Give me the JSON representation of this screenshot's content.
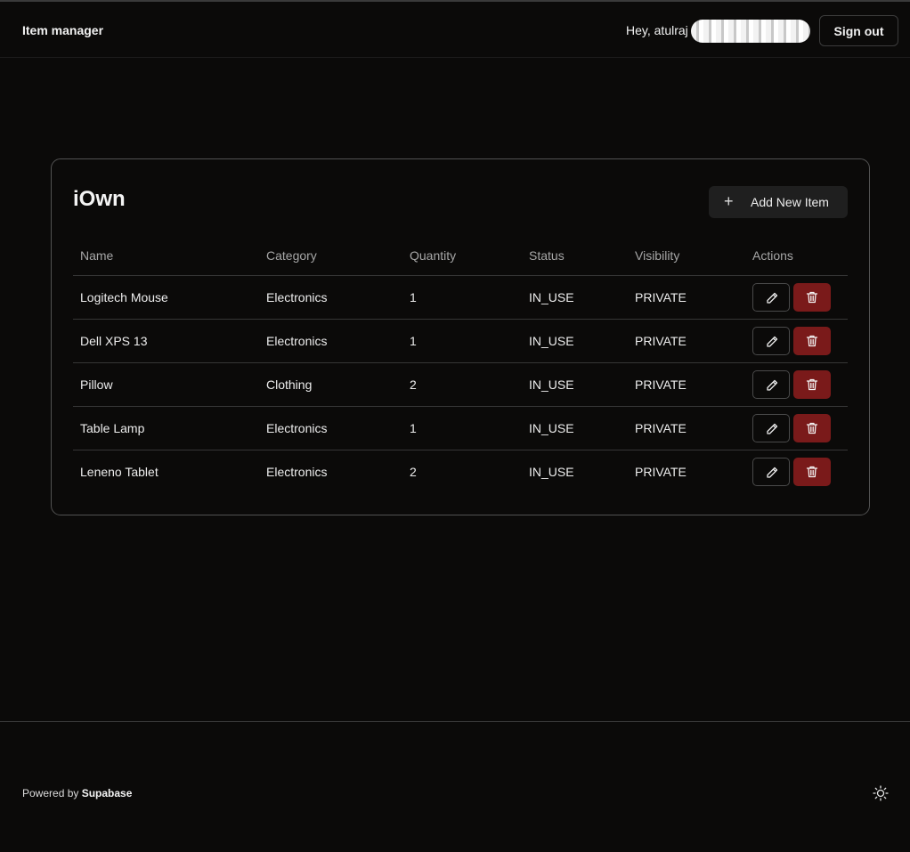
{
  "header": {
    "brand": "Item manager",
    "greeting": "Hey, atulraj",
    "sign_out_label": "Sign out"
  },
  "card": {
    "title": "iOwn",
    "add_button_label": "Add New Item",
    "add_button_icon": "plus-icon"
  },
  "table": {
    "columns": [
      "Name",
      "Category",
      "Quantity",
      "Status",
      "Visibility",
      "Actions"
    ],
    "rows": [
      {
        "name": "Logitech Mouse",
        "category": "Electronics",
        "quantity": "1",
        "status": "IN_USE",
        "visibility": "PRIVATE"
      },
      {
        "name": "Dell XPS 13",
        "category": "Electronics",
        "quantity": "1",
        "status": "IN_USE",
        "visibility": "PRIVATE"
      },
      {
        "name": "Pillow",
        "category": "Clothing",
        "quantity": "2",
        "status": "IN_USE",
        "visibility": "PRIVATE"
      },
      {
        "name": "Table Lamp",
        "category": "Electronics",
        "quantity": "1",
        "status": "IN_USE",
        "visibility": "PRIVATE"
      },
      {
        "name": "Leneno Tablet",
        "category": "Electronics",
        "quantity": "2",
        "status": "IN_USE",
        "visibility": "PRIVATE"
      }
    ],
    "row_action_icons": [
      "pencil-icon",
      "trash-icon"
    ]
  },
  "footer": {
    "powered_by_prefix": "Powered by",
    "powered_by_brand": "Supabase",
    "theme_icon": "sun-icon"
  },
  "colors": {
    "background": "#0b0a09",
    "delete_button": "#7a1a1a",
    "add_button": "#1f1f1f",
    "card_border": "#525252"
  }
}
